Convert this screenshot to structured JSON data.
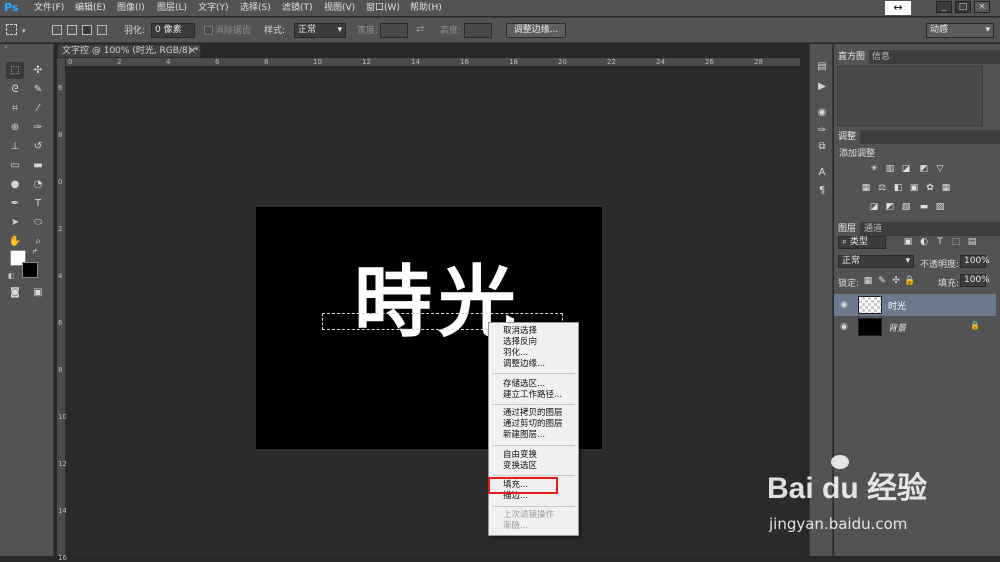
{
  "app": {
    "logo": "Ps"
  },
  "menubar": {
    "items": [
      "文件(F)",
      "编辑(E)",
      "图像(I)",
      "图层(L)",
      "文字(Y)",
      "选择(S)",
      "滤镜(T)",
      "视图(V)",
      "窗口(W)",
      "帮助(H)"
    ]
  },
  "window_controls": {
    "resize": "↔",
    "minimize": "_",
    "maximize": "□",
    "close": "×"
  },
  "options_bar": {
    "feather_label": "羽化:",
    "feather_value": "0 像素",
    "antialias_label": "消除锯齿",
    "style_label": "样式:",
    "style_value": "正常",
    "width_label": "宽度:",
    "height_label": "高度:",
    "refine_edge_button": "调整边缘...",
    "workspace_value": "动感"
  },
  "document": {
    "tab_title": "文字控 @ 100% (时光, RGB/8) *",
    "close": "×",
    "canvas_text_1": "時",
    "canvas_text_2": "光"
  },
  "ruler": {
    "top_ticks": [
      "0",
      "2",
      "4",
      "6",
      "8",
      "10",
      "12",
      "14",
      "16",
      "18",
      "20",
      "22",
      "24",
      "26",
      "28"
    ],
    "left_ticks": [
      "6",
      "8",
      "0",
      "2",
      "4",
      "6",
      "8",
      "10",
      "12",
      "14",
      "16"
    ]
  },
  "context_menu": {
    "group1": [
      "取消选择",
      "选择反向",
      "羽化...",
      "调整边缘..."
    ],
    "group2": [
      "存储选区...",
      "建立工作路径..."
    ],
    "group3": [
      "通过拷贝的图层",
      "通过剪切的图层",
      "新建图层..."
    ],
    "group4": [
      "自由变换",
      "变换选区"
    ],
    "group5": [
      "填充...",
      "描边..."
    ],
    "group6": [
      "上次滤镜操作",
      "渐隐..."
    ]
  },
  "panels": {
    "histogram_tabs": [
      "直方图",
      "信息"
    ],
    "adjust_tab": "调整",
    "adjust_title": "添加调整",
    "layers_tabs": [
      "图层",
      "通道"
    ],
    "layer_filter": "类型",
    "blend_mode": "正常",
    "opacity_label": "不透明度:",
    "opacity_value": "100%",
    "lock_label": "锁定:",
    "fill_label": "填充:",
    "fill_value": "100%",
    "layers": [
      {
        "name": "时光"
      },
      {
        "name": "背景"
      }
    ]
  },
  "watermark": {
    "brand": "Bai du 经验",
    "url": "jingyan.baidu.com"
  }
}
